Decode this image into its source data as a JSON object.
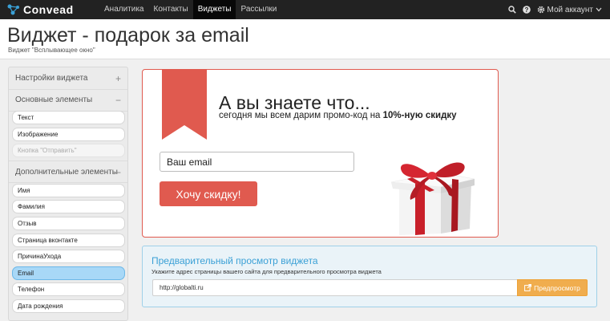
{
  "app": {
    "name": "Convead"
  },
  "nav": {
    "items": [
      {
        "label": "Аналитика"
      },
      {
        "label": "Контакты"
      },
      {
        "label": "Виджеты",
        "active": true
      },
      {
        "label": "Рассылки"
      }
    ]
  },
  "account": {
    "label": "Мой аккаунт"
  },
  "header": {
    "title": "Виджет - подарок за email",
    "subtitle": "Виджет \"Всплывающее окно\""
  },
  "sidebar": {
    "sections": [
      {
        "label": "Настройки виджета",
        "sign": "+"
      },
      {
        "label": "Основные элементы",
        "sign": "−"
      },
      {
        "label": "Дополнительные элементы",
        "sign": "−"
      }
    ],
    "basic_items": [
      {
        "label": "Текст"
      },
      {
        "label": "Изображение"
      },
      {
        "label": "Кнопка \"Отправить\"",
        "disabled": true
      }
    ],
    "extra_items": [
      {
        "label": "Имя"
      },
      {
        "label": "Фамилия"
      },
      {
        "label": "Отзыв"
      },
      {
        "label": "Страница вконтакте"
      },
      {
        "label": "ПричинаУхода"
      },
      {
        "label": "Email",
        "active": true
      },
      {
        "label": "Телефон"
      },
      {
        "label": "Дата рождения"
      }
    ]
  },
  "widget": {
    "title": "А вы знаете что...",
    "subtitle_prefix": "сегодня мы всем дарим промо-код на ",
    "subtitle_bold": "10%-ную скидку",
    "email_placeholder": "Ваш email",
    "cta_label": "Хочу скидку!",
    "accent": "#e05a4f"
  },
  "preview": {
    "title": "Предварительный просмотр виджета",
    "hint": "Укажите адрес страницы вашего сайта для предварительного просмотра виджета",
    "url_value": "http://globalti.ru",
    "button_label": "Предпросмотр",
    "button_color": "#f0ad4e"
  },
  "icons": [
    "logo-icon",
    "search-icon",
    "help-icon",
    "gear-icon",
    "chevron-down-icon",
    "external-link-icon",
    "ribbon-icon",
    "gift-icon"
  ]
}
